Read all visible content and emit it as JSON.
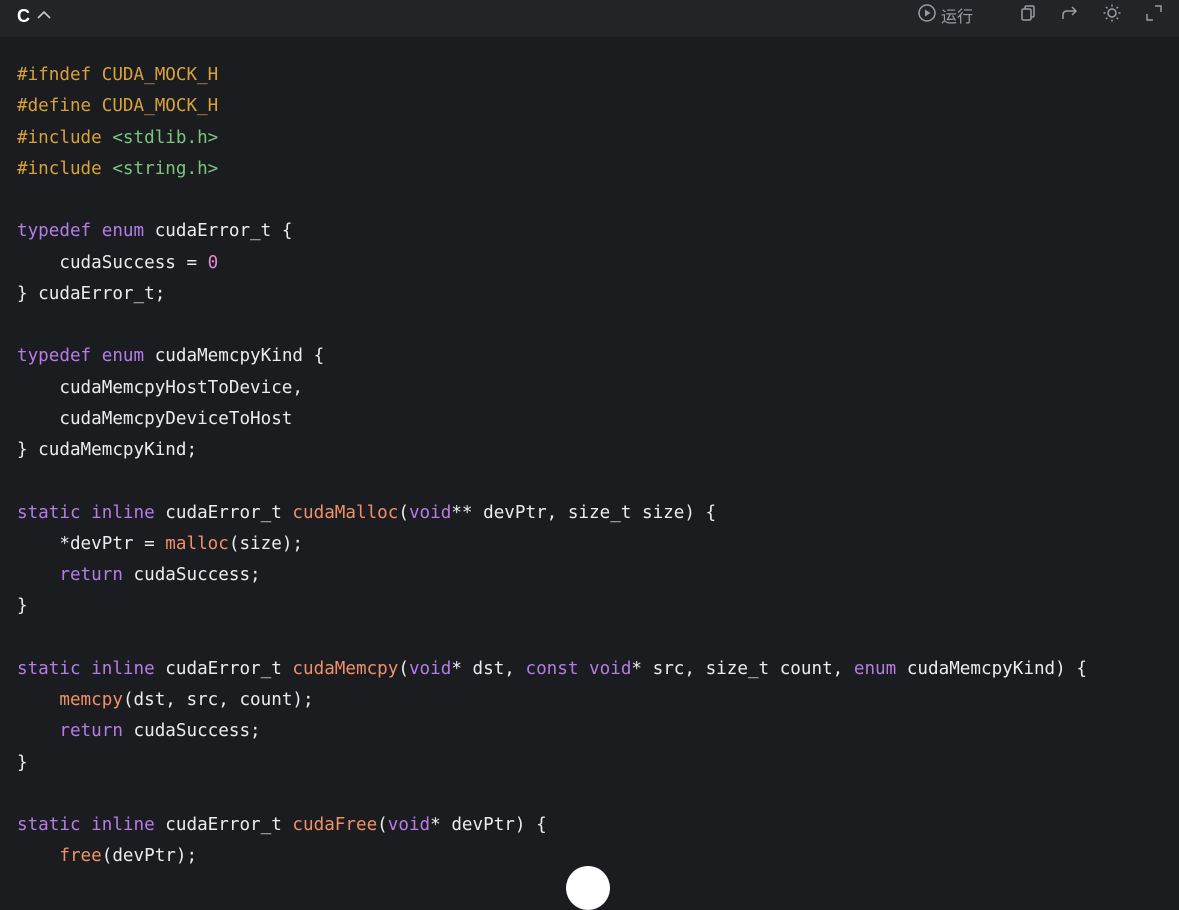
{
  "header": {
    "language": "C",
    "toolbar": {
      "run_label": "运行"
    }
  },
  "code": {
    "lines": [
      [
        {
          "t": "pre",
          "s": "#ifndef "
        },
        {
          "t": "mac",
          "s": "CUDA_MOCK_H"
        }
      ],
      [
        {
          "t": "pre",
          "s": "#define "
        },
        {
          "t": "mac",
          "s": "CUDA_MOCK_H"
        }
      ],
      [
        {
          "t": "pre",
          "s": "#include "
        },
        {
          "t": "inc",
          "s": "<stdlib.h>"
        }
      ],
      [
        {
          "t": "pre",
          "s": "#include "
        },
        {
          "t": "inc",
          "s": "<string.h>"
        }
      ],
      [],
      [
        {
          "t": "kw",
          "s": "typedef"
        },
        {
          "t": "pl",
          "s": " "
        },
        {
          "t": "kw",
          "s": "enum"
        },
        {
          "t": "pl",
          "s": " cudaError_t {"
        }
      ],
      [
        {
          "t": "pl",
          "s": "    cudaSuccess = "
        },
        {
          "t": "num",
          "s": "0"
        }
      ],
      [
        {
          "t": "pl",
          "s": "} cudaError_t;"
        }
      ],
      [],
      [
        {
          "t": "kw",
          "s": "typedef"
        },
        {
          "t": "pl",
          "s": " "
        },
        {
          "t": "kw",
          "s": "enum"
        },
        {
          "t": "pl",
          "s": " cudaMemcpyKind {"
        }
      ],
      [
        {
          "t": "pl",
          "s": "    cudaMemcpyHostToDevice,"
        }
      ],
      [
        {
          "t": "pl",
          "s": "    cudaMemcpyDeviceToHost"
        }
      ],
      [
        {
          "t": "pl",
          "s": "} cudaMemcpyKind;"
        }
      ],
      [],
      [
        {
          "t": "kw",
          "s": "static"
        },
        {
          "t": "pl",
          "s": " "
        },
        {
          "t": "kw",
          "s": "inline"
        },
        {
          "t": "pl",
          "s": " cudaError_t "
        },
        {
          "t": "fn",
          "s": "cudaMalloc"
        },
        {
          "t": "pl",
          "s": "("
        },
        {
          "t": "kw",
          "s": "void"
        },
        {
          "t": "pl",
          "s": "** devPtr, size_t size) {"
        }
      ],
      [
        {
          "t": "pl",
          "s": "    *devPtr = "
        },
        {
          "t": "fn",
          "s": "malloc"
        },
        {
          "t": "pl",
          "s": "(size);"
        }
      ],
      [
        {
          "t": "pl",
          "s": "    "
        },
        {
          "t": "kw",
          "s": "return"
        },
        {
          "t": "pl",
          "s": " cudaSuccess;"
        }
      ],
      [
        {
          "t": "pl",
          "s": "}"
        }
      ],
      [],
      [
        {
          "t": "kw",
          "s": "static"
        },
        {
          "t": "pl",
          "s": " "
        },
        {
          "t": "kw",
          "s": "inline"
        },
        {
          "t": "pl",
          "s": " cudaError_t "
        },
        {
          "t": "fn",
          "s": "cudaMemcpy"
        },
        {
          "t": "pl",
          "s": "("
        },
        {
          "t": "kw",
          "s": "void"
        },
        {
          "t": "pl",
          "s": "* dst, "
        },
        {
          "t": "kw",
          "s": "const"
        },
        {
          "t": "pl",
          "s": " "
        },
        {
          "t": "kw",
          "s": "void"
        },
        {
          "t": "pl",
          "s": "* src, size_t count, "
        },
        {
          "t": "kw",
          "s": "enum"
        },
        {
          "t": "pl",
          "s": " cudaMemcpyKind) {"
        }
      ],
      [
        {
          "t": "pl",
          "s": "    "
        },
        {
          "t": "fn",
          "s": "memcpy"
        },
        {
          "t": "pl",
          "s": "(dst, src, count);"
        }
      ],
      [
        {
          "t": "pl",
          "s": "    "
        },
        {
          "t": "kw",
          "s": "return"
        },
        {
          "t": "pl",
          "s": " cudaSuccess;"
        }
      ],
      [
        {
          "t": "pl",
          "s": "}"
        }
      ],
      [],
      [
        {
          "t": "kw",
          "s": "static"
        },
        {
          "t": "pl",
          "s": " "
        },
        {
          "t": "kw",
          "s": "inline"
        },
        {
          "t": "pl",
          "s": " cudaError_t "
        },
        {
          "t": "fn",
          "s": "cudaFree"
        },
        {
          "t": "pl",
          "s": "("
        },
        {
          "t": "kw",
          "s": "void"
        },
        {
          "t": "pl",
          "s": "* devPtr) {"
        }
      ],
      [
        {
          "t": "pl",
          "s": "    "
        },
        {
          "t": "fn",
          "s": "free"
        },
        {
          "t": "pl",
          "s": "(devPtr);"
        }
      ]
    ]
  },
  "colors": {
    "background": "#1b1c20",
    "header_bg": "#232428",
    "preprocessor": "#d9a13a",
    "include_path": "#7bc57f",
    "keyword": "#b57ce6",
    "function": "#f0906a",
    "number": "#e58ad0",
    "plain": "#ececec"
  },
  "icons": [
    "chevron-up-icon",
    "play-circle-icon",
    "copy-icon",
    "share-arrow-icon",
    "sun-theme-icon",
    "expand-icon"
  ]
}
